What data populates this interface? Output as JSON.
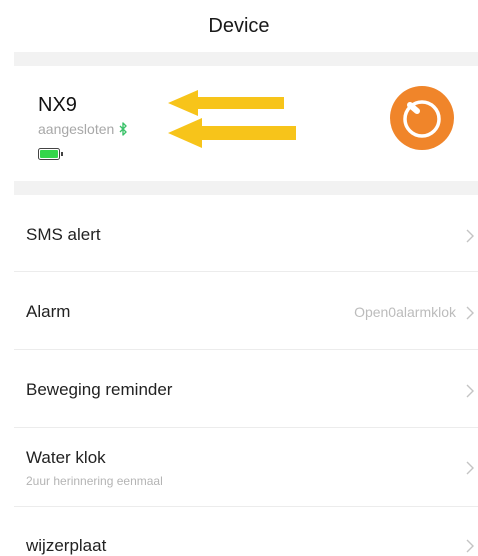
{
  "header": {
    "title": "Device"
  },
  "device": {
    "name": "NX9",
    "status": "aangesloten"
  },
  "colors": {
    "accent_orange": "#f0852a",
    "battery_green": "#33d64a",
    "bluetooth_green": "#3cc26a",
    "arrow_yellow": "#f7c41a"
  },
  "menu": [
    {
      "label": "SMS alert",
      "value": "",
      "subtitle": ""
    },
    {
      "label": "Alarm",
      "value": "Open0alarmklok",
      "subtitle": ""
    },
    {
      "label": "Beweging reminder",
      "value": "",
      "subtitle": ""
    },
    {
      "label": "Water klok",
      "value": "",
      "subtitle": "2uur herinnering eenmaal"
    },
    {
      "label": "wijzerplaat",
      "value": "",
      "subtitle": ""
    }
  ]
}
